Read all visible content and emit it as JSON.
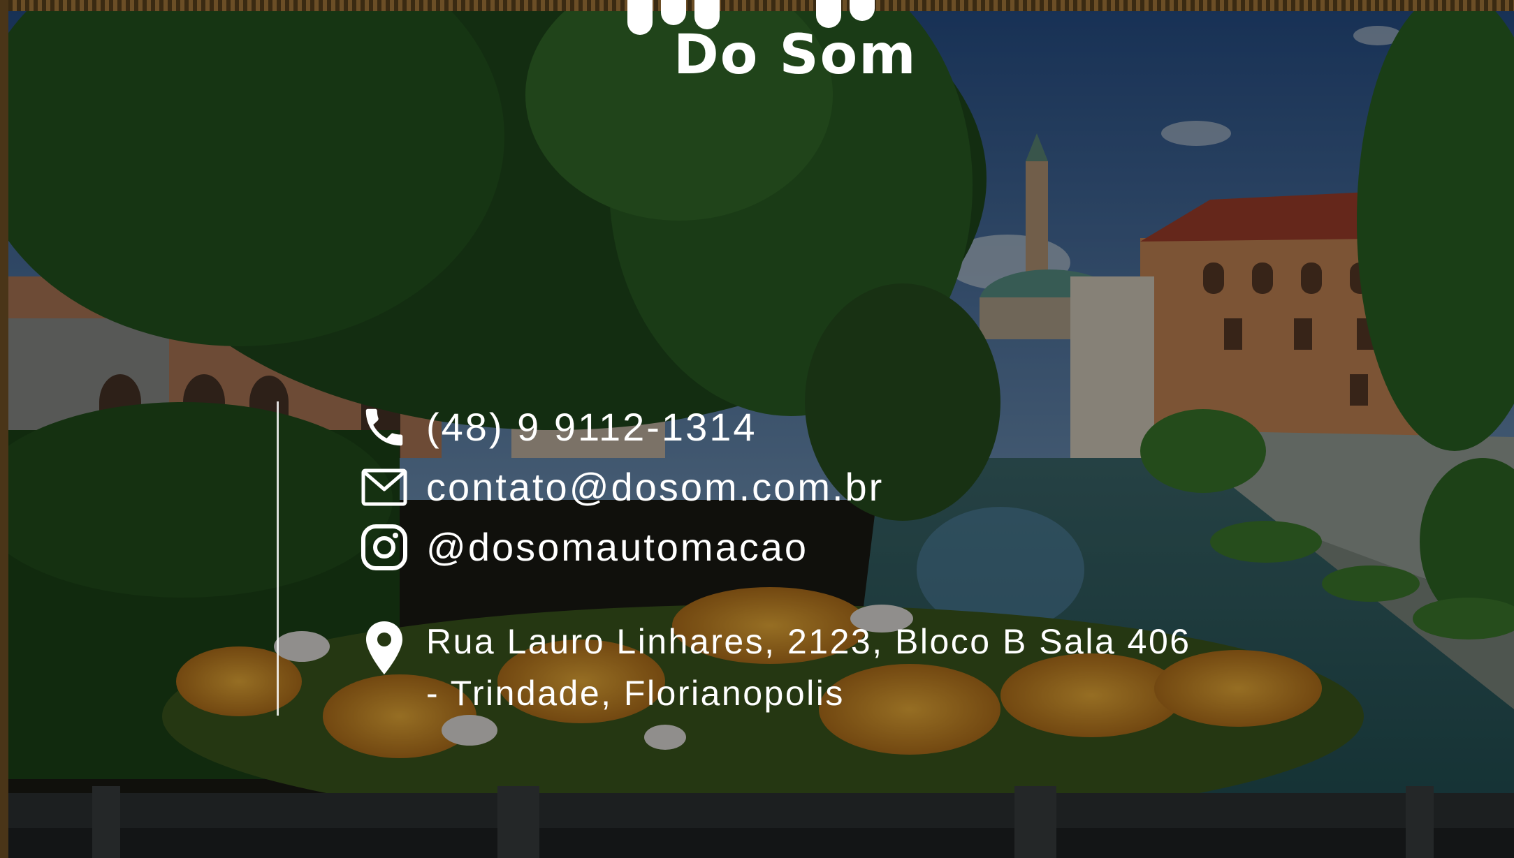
{
  "logo": {
    "text": "Do Som",
    "icon": "equalizer-bars-icon"
  },
  "contact": {
    "phone": {
      "icon": "phone-icon",
      "text": "(48) 9 9112-1314"
    },
    "email": {
      "icon": "mail-icon",
      "text": "contato@dosom.com.br"
    },
    "instagram": {
      "icon": "instagram-icon",
      "text": "@dosomautomacao"
    },
    "address": {
      "icon": "location-pin-icon",
      "line1": "Rua Lauro Linhares, 2123, Bloco B Sala 406",
      "line2": "- Trindade, Florianopolis"
    }
  },
  "colors": {
    "text": "#ffffff",
    "overlay": "#000000",
    "foliage": "#1f4a1c",
    "sky": "#2f5f9a",
    "water": "#3b6f8a",
    "flowers": "#e0a030"
  }
}
